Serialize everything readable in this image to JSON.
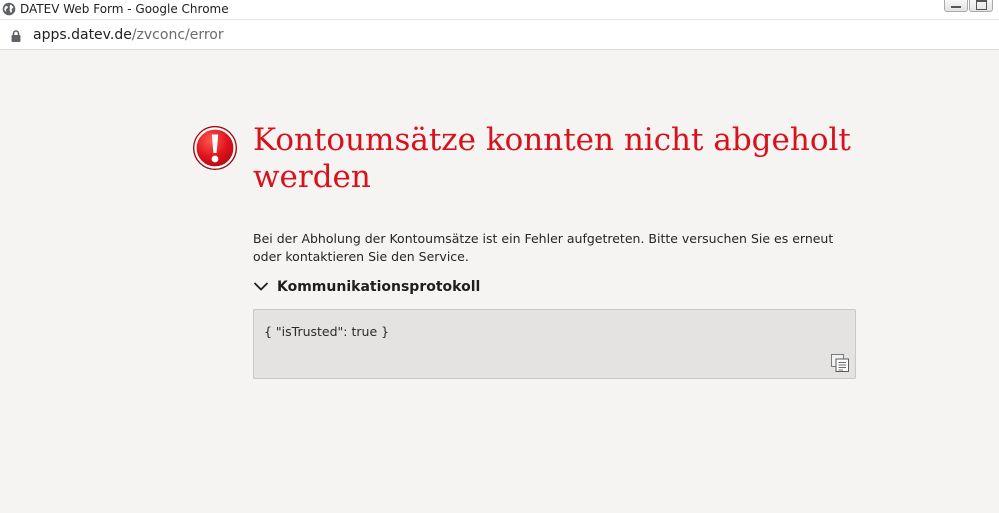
{
  "window": {
    "title": "DATEV Web Form - Google Chrome",
    "icon": "globe-icon",
    "controls": [
      "minimize-icon",
      "maximize-icon"
    ]
  },
  "address_bar": {
    "host": "apps.datev.de",
    "path": "/zvconc/error",
    "icon": "lock-icon"
  },
  "error": {
    "icon": "exclamation-icon",
    "title": "Kontoumsätze konnten nicht abgeholt werden",
    "description": "Bei der Abholung der Kontoumsätze ist ein Fehler aufgetreten. Bitte versuchen Sie es erneut oder kontaktieren Sie den Service.",
    "protocol_label": "Kommunikationsprotokoll",
    "protocol_expanded": true,
    "protocol_content": "{ \"isTrusted\": true }",
    "copy_icon": "copy-icon"
  },
  "colors": {
    "accent": "#d8121c",
    "background": "#f5f4f2",
    "protocol_background": "#e4e3e1"
  }
}
